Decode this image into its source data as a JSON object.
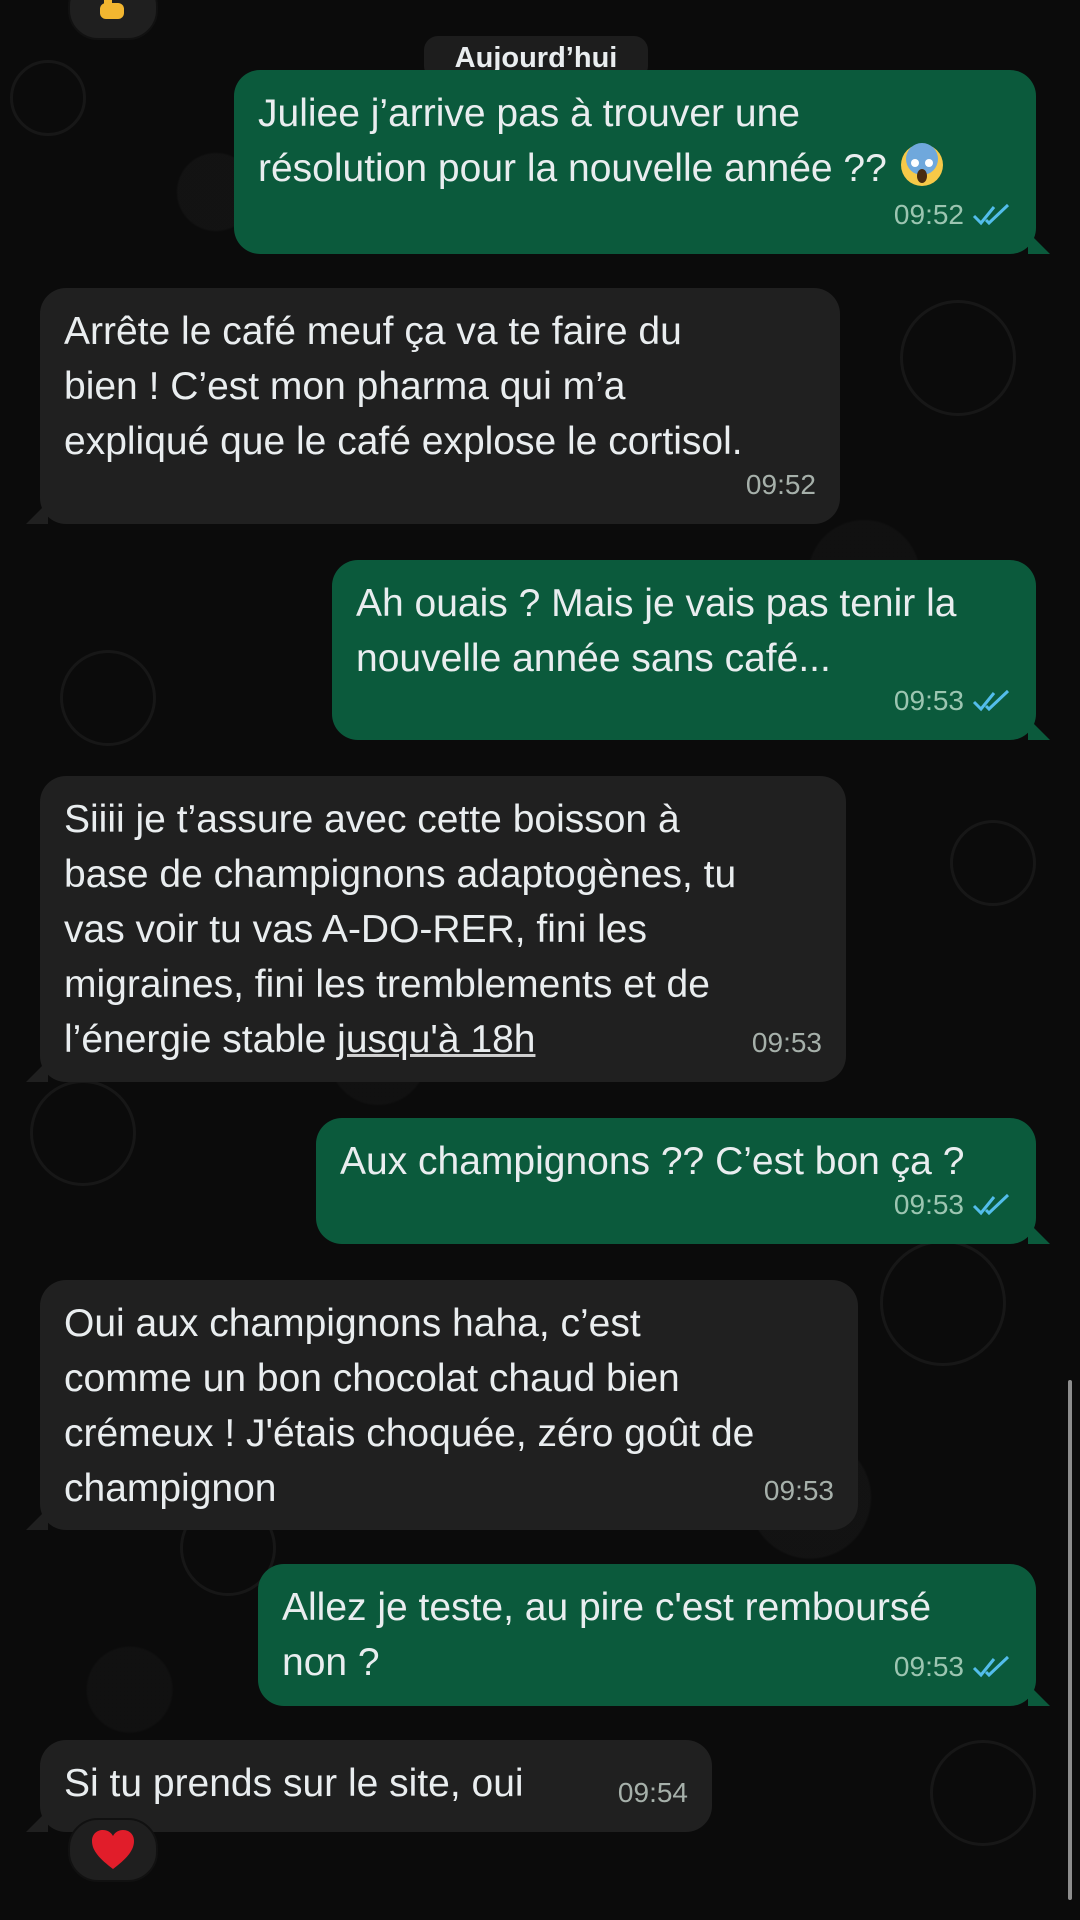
{
  "date_separator": "Aujourd’hui",
  "messages": [
    {
      "dir": "out",
      "text": "Juliee j’arrive pas à trouver une\nrésolution pour la nouvelle année ??",
      "emoji": "scream",
      "time": "09:52"
    },
    {
      "dir": "in",
      "text": "Arrête le café meuf ça va te faire du\nbien ! C’est mon pharma qui m’a\nexpliqué que le café explose le cortisol.",
      "time": "09:52"
    },
    {
      "dir": "out",
      "text": "Ah ouais ? Mais je vais pas tenir la\nnouvelle année sans café...",
      "time": "09:53"
    },
    {
      "dir": "in",
      "text_main": "Siiii je t’assure avec cette boisson à\nbase de champignons adaptogènes, tu\nvas voir tu vas A-DO-RER, fini les\nmigraines, fini les tremblements et de\nl’énergie stable ",
      "link": "jusqu'à 18h",
      "time": "09:53"
    },
    {
      "dir": "out",
      "text": "Aux champignons ?? C’est bon ça ?",
      "time": "09:53"
    },
    {
      "dir": "in",
      "text": "Oui aux champignons haha, c’est\ncomme un bon chocolat chaud bien\ncrémeux ! J'étais choquée, zéro goût de\nchampignon",
      "time": "09:53"
    },
    {
      "dir": "out",
      "text": "Allez je teste, au pire c'est remboursé\nnon ?",
      "time": "09:53"
    },
    {
      "dir": "in",
      "text": "Si tu prends sur le site, oui",
      "time": "09:54"
    }
  ],
  "reactions": {
    "top": "thumbs-icon",
    "bottom": "heart-icon"
  },
  "colors": {
    "outgoing": "#0b5a3c",
    "incoming": "#202020",
    "ticks": "#53bdeb"
  }
}
